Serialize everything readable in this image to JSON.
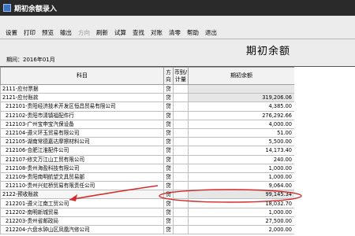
{
  "window": {
    "title": "期初余额录入"
  },
  "toolbar": {
    "items": [
      {
        "label": "设置",
        "enabled": true
      },
      {
        "label": "打印",
        "enabled": true
      },
      {
        "label": "预览",
        "enabled": true
      },
      {
        "label": "输出",
        "enabled": true
      },
      {
        "label": "方向",
        "enabled": false
      },
      {
        "label": "刷新",
        "enabled": true
      },
      {
        "label": "试算",
        "enabled": true
      },
      {
        "label": "查找",
        "enabled": true
      },
      {
        "label": "对账",
        "enabled": true
      },
      {
        "label": "清零",
        "enabled": true
      },
      {
        "label": "帮助",
        "enabled": true
      },
      {
        "label": "退出",
        "enabled": true
      }
    ]
  },
  "header": {
    "page_title": "期初余额",
    "period": "期间：2016年01月"
  },
  "table": {
    "columns": [
      "科目",
      "方向",
      "币别/计量",
      "期初余额"
    ],
    "rows": [
      {
        "subject": "2111-应付票据",
        "dir": "贷",
        "balance": "",
        "shaded": true
      },
      {
        "subject": "2121-应付账款",
        "dir": "贷",
        "balance": "319,206.06",
        "shaded": true
      },
      {
        "subject": "212101-贵阳经济技术开发区恒昌贸易有限公司",
        "dir": "贷",
        "balance": "4,385.00",
        "shaded": false
      },
      {
        "subject": "212102-贵阳市清镇福配件行",
        "dir": "贷",
        "balance": "276,292.66",
        "shaded": false
      },
      {
        "subject": "212103-广州宝申宝汽保设备",
        "dir": "贷",
        "balance": "4,000.00",
        "shaded": false
      },
      {
        "subject": "212104-遵义环玉贸易有限公司",
        "dir": "贷",
        "balance": "51.00",
        "shaded": false
      },
      {
        "subject": "212105-湖南常德嘉达摩擦材料公司",
        "dir": "贷",
        "balance": "5,500.00",
        "shaded": false
      },
      {
        "subject": "212106-合肥江淮配件公司",
        "dir": "贷",
        "balance": "14,173.40",
        "shaded": false
      },
      {
        "subject": "212107-修文万江山工贸有限公司",
        "dir": "贷",
        "balance": "240.00",
        "shaded": false
      },
      {
        "subject": "212108-贵州海盈科技有限公司",
        "dir": "贷",
        "balance": "1,000.00",
        "shaded": false
      },
      {
        "subject": "212109-贵阳南明航望文具贸易部",
        "dir": "贷",
        "balance": "1,000.00",
        "shaded": false
      },
      {
        "subject": "212110-贵州兴虹桥贸易有限责任公司",
        "dir": "贷",
        "balance": "9,064.00",
        "shaded": false
      },
      {
        "subject": "2122-预收账款",
        "dir": "贷",
        "balance": "99,145.34",
        "shaded": true,
        "selected": true
      },
      {
        "subject": "212201-遵义江南工贸公司",
        "dir": "贷",
        "balance": "18,032.70",
        "shaded": false
      },
      {
        "subject": "212202-南明新城贸易",
        "dir": "贷",
        "balance": "1,000.00",
        "shaded": false
      },
      {
        "subject": "212203-贵州省邮政局",
        "dir": "贷",
        "balance": "27,500.00",
        "shaded": false
      },
      {
        "subject": "212204-六盘水钟山区凤凰汽修公司",
        "dir": "贷",
        "balance": "2,000.00",
        "shaded": false
      }
    ]
  },
  "colors": {
    "titlebar_bg": "#2a2a2a",
    "annotation_red": "#d62a2a",
    "shaded_cell": "#e6e6e6"
  }
}
